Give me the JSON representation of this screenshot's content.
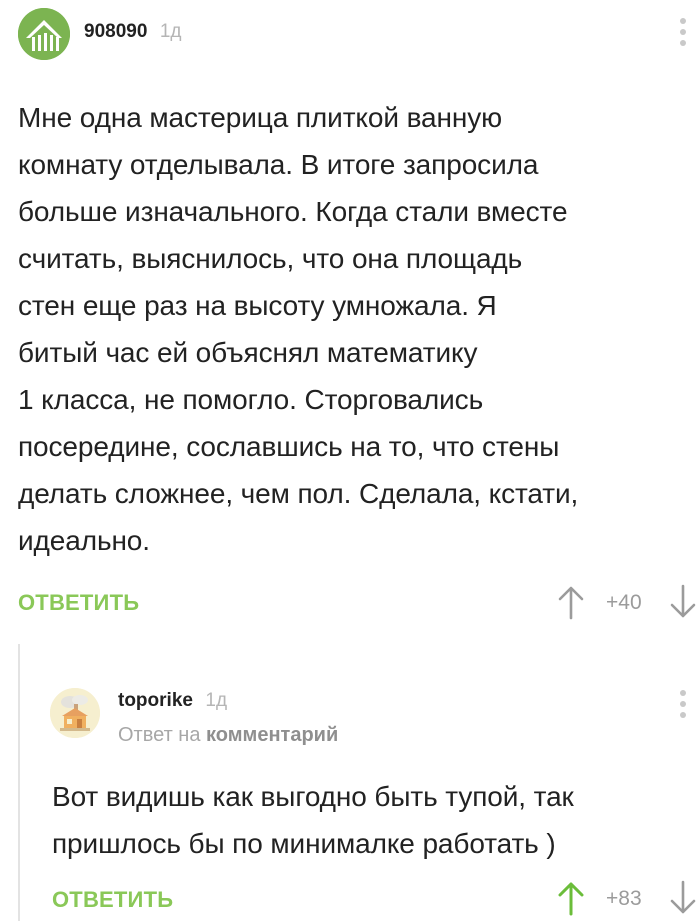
{
  "comment": {
    "author": "908090",
    "time": "1д",
    "text_lines": [
      "Мне одна мастерица плиткой ванную",
      "комнату отделывала. В итоге запросила",
      "больше изначального. Когда стали вместе",
      "считать, выяснилось, что она площадь",
      "стен еще раз на высоту умножала. Я",
      "битый час ей объяснял математику",
      "1 класса, не помогло. Сторговались",
      "посередине, сославшись на то, что стены",
      "делать сложнее, чем пол. Сделала, кстати,",
      "идеально."
    ],
    "reply_label": "ОТВЕТИТЬ",
    "rating": "+40"
  },
  "reply": {
    "author": "toporike",
    "time": "1д",
    "reply_to_prefix": "Ответ на",
    "reply_to_target": "комментарий",
    "text_lines": [
      "Вот видишь как выгодно быть тупой, так",
      "пришлось бы по минималке работать )"
    ],
    "reply_label": "ОТВЕТИТЬ",
    "rating": "+83"
  },
  "colors": {
    "accent_green": "#8ac858",
    "upvoted_green": "#6bbd3a",
    "muted_gray": "#9b9b9b"
  },
  "icons": [
    "avatar-main",
    "avatar-reply",
    "more-icon",
    "upvote-icon",
    "downvote-icon"
  ]
}
